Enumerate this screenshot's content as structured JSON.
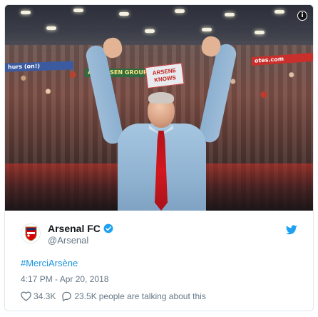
{
  "tweet": {
    "author": {
      "name": "Arsenal FC",
      "handle": "@Arsenal",
      "verified": true
    },
    "text": "#MerciArsène",
    "timestamp": "4:17 PM - Apr 20, 2018",
    "likes": "34.3K",
    "replies": "23.5K",
    "talking_label": "people are talking about this"
  },
  "photo": {
    "banner_left": "hurs (on!)",
    "banner_mid": "ANDERSEN GROUP",
    "banner_right": "otes.com",
    "sign_text": "ARSENE KNOWS"
  },
  "icons": {
    "info": "info-icon",
    "verified": "verified-badge-icon",
    "brand": "twitter-bird-icon",
    "like": "heart-icon",
    "reply": "speech-bubble-icon",
    "avatar": "arsenal-crest-icon"
  },
  "colors": {
    "link": "#1b95e0",
    "muted": "#657786",
    "text": "#14171a",
    "brand": "#1da1f2",
    "border": "#e1e8ed"
  }
}
